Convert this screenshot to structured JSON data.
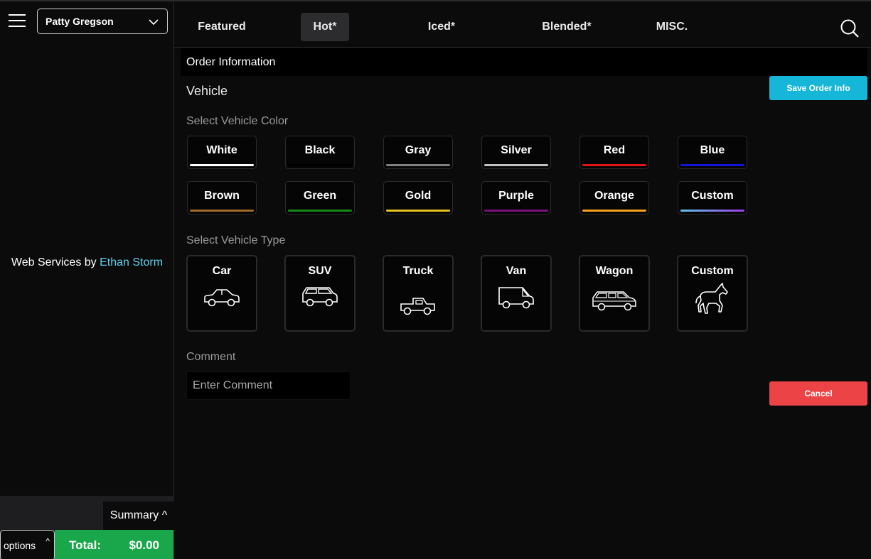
{
  "user": {
    "name": "Patty Gregson"
  },
  "credit": {
    "prefix": "Web Services by ",
    "link": "Ethan Storm"
  },
  "footer": {
    "summary": "Summary ^",
    "options": "options",
    "options_caret": "^",
    "total_label": "Total:",
    "total_value": "$0.00"
  },
  "tabs": [
    {
      "label": "Featured",
      "active": false
    },
    {
      "label": "Hot*",
      "active": true
    },
    {
      "label": "Iced*",
      "active": false
    },
    {
      "label": "Blended*",
      "active": false
    },
    {
      "label": "MISC.",
      "active": false
    }
  ],
  "order": {
    "header": "Order Information",
    "section": "Vehicle",
    "color_label": "Select Vehicle Color",
    "type_label": "Select Vehicle Type",
    "comment_label": "Comment",
    "comment_placeholder": "Enter Comment",
    "colors": [
      {
        "label": "White",
        "bar": "#ffffff"
      },
      {
        "label": "Black",
        "bar": "#000000"
      },
      {
        "label": "Gray",
        "bar": "#808080"
      },
      {
        "label": "Silver",
        "bar": "#c0c0c0"
      },
      {
        "label": "Red",
        "bar": "#e01414"
      },
      {
        "label": "Blue",
        "bar": "#1414d8"
      },
      {
        "label": "Brown",
        "bar": "#a0692a"
      },
      {
        "label": "Green",
        "bar": "#168a16"
      },
      {
        "label": "Gold",
        "bar": "#e6c21e"
      },
      {
        "label": "Purple",
        "bar": "#7a107a"
      },
      {
        "label": "Orange",
        "bar": "#f5a11e"
      },
      {
        "label": "Custom",
        "bar": "linear-gradient(90deg,#5ec6e8,#9b3fe8)"
      }
    ],
    "types": [
      {
        "label": "Car",
        "icon": "car-icon"
      },
      {
        "label": "SUV",
        "icon": "suv-icon"
      },
      {
        "label": "Truck",
        "icon": "truck-icon"
      },
      {
        "label": "Van",
        "icon": "van-icon"
      },
      {
        "label": "Wagon",
        "icon": "wagon-icon"
      },
      {
        "label": "Custom",
        "icon": "horse-icon"
      }
    ]
  },
  "actions": {
    "save": "Save Order Info",
    "cancel": "Cancel"
  }
}
